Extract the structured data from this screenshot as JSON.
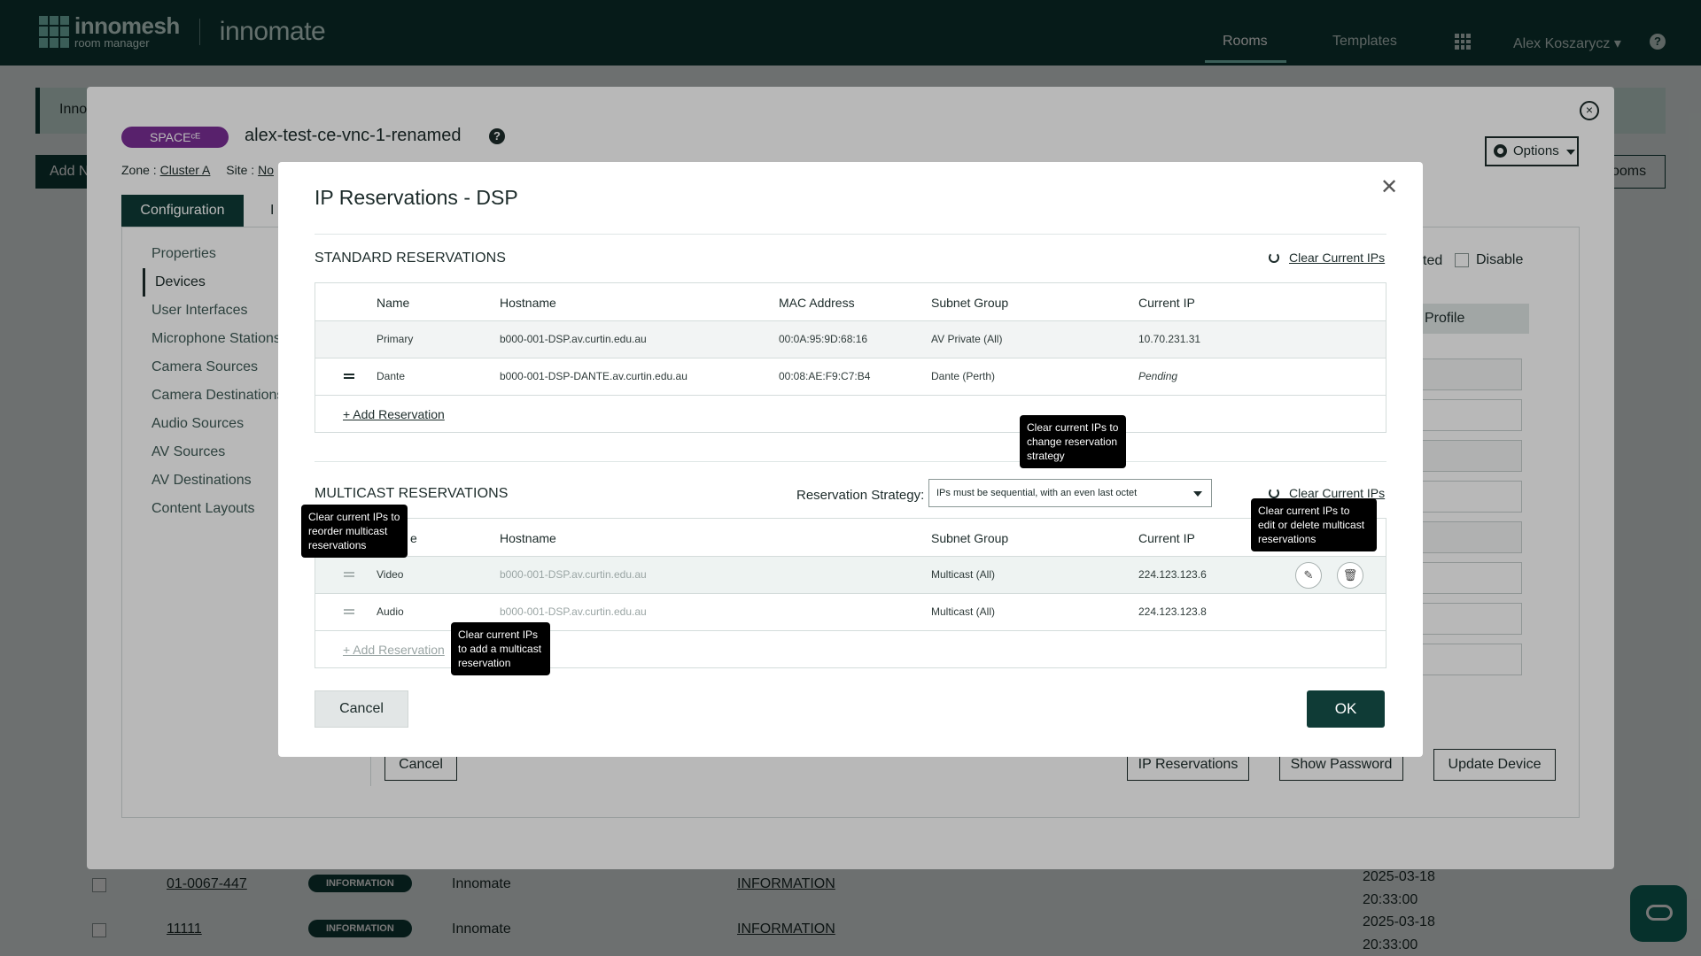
{
  "nav": {
    "brand": "innomesh",
    "brand_sub": "room manager",
    "product": "innomate",
    "links": [
      "Rooms",
      "Templates"
    ],
    "user": "Alex Koszarycz ▾",
    "help": "?"
  },
  "background": {
    "banner_text": "Inno",
    "add_button": "Add N",
    "rooms_button": "ooms",
    "rows": [
      {
        "id": "01-0067-447",
        "badge": "INFORMATION",
        "who": "Innomate",
        "info": "INFORMATION",
        "date1": "2025-03-18",
        "date2": "20:33:00"
      },
      {
        "id": "11111",
        "badge": "INFORMATION",
        "who": "Innomate",
        "info": "INFORMATION",
        "date1": "2025-03-18",
        "date2": "20:33:00"
      }
    ]
  },
  "space_modal": {
    "badge": "SPACEᶜᴱ",
    "title": "alex-test-ce-vnc-1-renamed",
    "zone_label": "Zone :",
    "zone_value": "Cluster A",
    "site_label": "Site :",
    "site_value": "No",
    "options": "Options",
    "tabs": {
      "active": "Configuration",
      "other": "I"
    },
    "menu": [
      "Properties",
      "Devices",
      "User Interfaces",
      "Microphone Stations",
      "Camera Sources",
      "Camera Destinations",
      "Audio Sources",
      "AV Sources",
      "AV Destinations",
      "Content Layouts"
    ],
    "right": {
      "suffix": "ted",
      "disable": "Disable",
      "profile": "Profile"
    },
    "buttons": {
      "cancel": "Cancel",
      "ip_reservations": "IP Reservations",
      "show_password": "Show Password",
      "update_device": "Update Device"
    }
  },
  "ip_modal": {
    "title": "IP Reservations - DSP",
    "standard": {
      "heading": "STANDARD RESERVATIONS",
      "clear_label": "Clear Current IPs",
      "columns": [
        "Name",
        "Hostname",
        "MAC Address",
        "Subnet Group",
        "Current IP"
      ],
      "rows": [
        {
          "name": "Primary",
          "hostname": "b000-001-DSP.av.curtin.edu.au",
          "mac": "00:0A:95:9D:68:16",
          "subnet": "AV Private (All)",
          "ip": "10.70.231.31"
        },
        {
          "name": "Dante",
          "hostname": "b000-001-DSP-DANTE.av.curtin.edu.au",
          "mac": "00:08:AE:F9:C7:B4",
          "subnet": "Dante (Perth)",
          "ip": "Pending"
        }
      ],
      "add_label": "+ Add Reservation"
    },
    "multicast": {
      "heading": "MULTICAST RESERVATIONS",
      "strategy_label": "Reservation Strategy:",
      "strategy_value": "IPs must be sequential, with an even last octet",
      "clear_label": "Clear Current IPs",
      "columns": [
        "e",
        "Hostname",
        "Subnet Group",
        "Current IP"
      ],
      "rows": [
        {
          "name": "Video",
          "hostname": "b000-001-DSP.av.curtin.edu.au",
          "subnet": "Multicast (All)",
          "ip": "224.123.123.6"
        },
        {
          "name": "Audio",
          "hostname": "b000-001-DSP.av.curtin.edu.au",
          "subnet": "Multicast (All)",
          "ip": "224.123.123.8"
        }
      ],
      "add_label": "+ Add Reservation"
    },
    "tooltips": {
      "strategy": "Clear current IPs to change reservation strategy",
      "reorder": "Clear current IPs to reorder multicast reservations",
      "edit_delete": "Clear current IPs to edit or delete multicast reservations",
      "add": "Clear current IPs to add a multicast reservation"
    },
    "buttons": {
      "cancel": "Cancel",
      "ok": "OK"
    }
  },
  "icons": [
    "logo-grid-icon",
    "apps-grid-icon",
    "help-icon",
    "close-icon",
    "gear-icon",
    "refresh-icon",
    "drag-handle-icon",
    "pencil-icon",
    "trash-icon",
    "caret-down-icon",
    "chat-icon"
  ]
}
